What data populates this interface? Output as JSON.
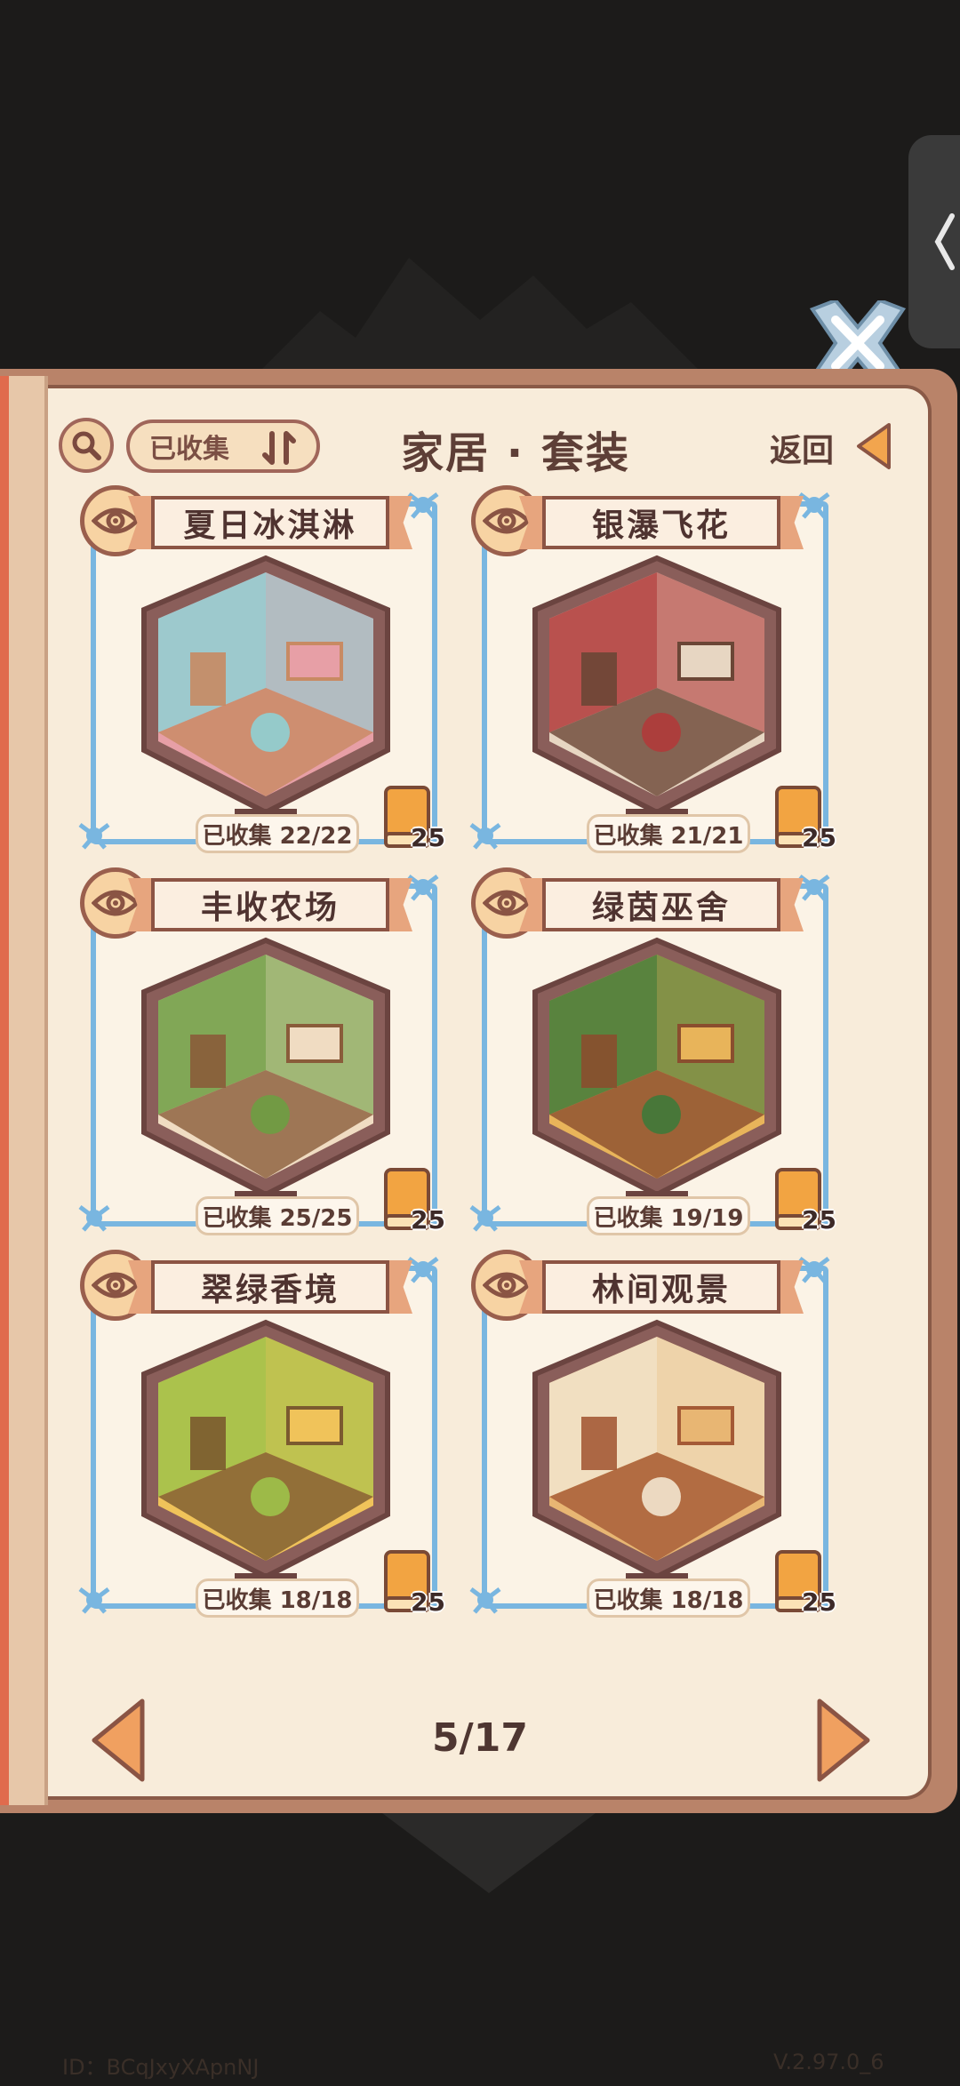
{
  "header": {
    "filter_label": "已收集",
    "title": "家居 · 套装",
    "back_label": "返回"
  },
  "suits": [
    {
      "name": "夏日冰淇淋",
      "collected": "已收集 22/22",
      "book_count": "25",
      "palette": [
        "#8fd0d4",
        "#e79fa6",
        "#c88a63"
      ]
    },
    {
      "name": "银瀑飞花",
      "collected": "已收集 21/21",
      "book_count": "25",
      "palette": [
        "#b03a3a",
        "#e7d6c2",
        "#6b4636"
      ]
    },
    {
      "name": "丰收农场",
      "collected": "已收集 25/25",
      "book_count": "25",
      "palette": [
        "#6d9e43",
        "#f0dcc2",
        "#8a5c3a"
      ]
    },
    {
      "name": "绿茵巫舍",
      "collected": "已收集 19/19",
      "book_count": "25",
      "palette": [
        "#3f7a3a",
        "#e8b45a",
        "#8a4e2e"
      ]
    },
    {
      "name": "翠绿香境",
      "collected": "已收集 18/18",
      "book_count": "25",
      "palette": [
        "#9fc24a",
        "#f0c35a",
        "#7b5a2f"
      ]
    },
    {
      "name": "林间观景",
      "collected": "已收集 18/18",
      "book_count": "25",
      "palette": [
        "#f2e6cf",
        "#e8b673",
        "#a45a36"
      ]
    }
  ],
  "pager": {
    "text": "5/17"
  },
  "footer": {
    "id": "ID：BCqJxyXApnNJ",
    "version": "V.2.97.0_6"
  },
  "colors": {
    "frame_blue": "#79b6e0",
    "page_bg": "#f8ecda",
    "accent_orange": "#e8894a"
  }
}
